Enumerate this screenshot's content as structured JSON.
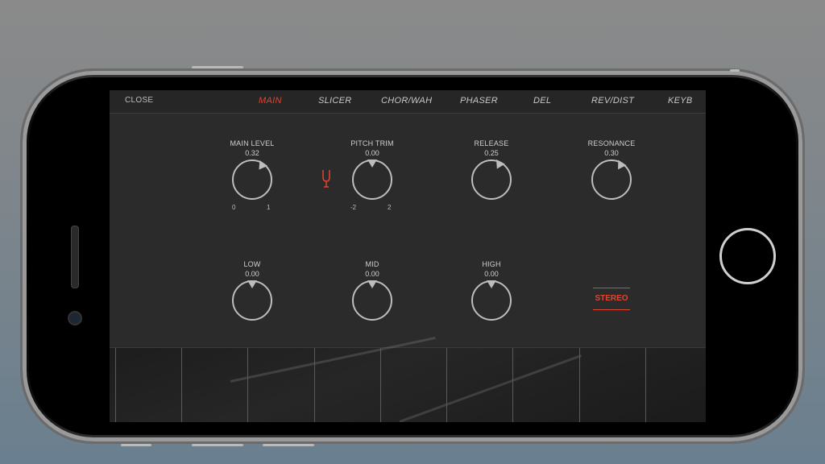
{
  "nav": {
    "close_label": "CLOSE",
    "tabs": [
      {
        "label": "MAIN",
        "active": true
      },
      {
        "label": "SLICER",
        "active": false
      },
      {
        "label": "CHOR/WAH",
        "active": false
      },
      {
        "label": "PHASER",
        "active": false
      },
      {
        "label": "DEL",
        "active": false
      },
      {
        "label": "REV/DIST",
        "active": false
      },
      {
        "label": "KEYB",
        "active": false
      }
    ]
  },
  "knobs": {
    "main_level": {
      "label": "MAIN LEVEL",
      "value": "0.32",
      "min": "0",
      "max": "1"
    },
    "pitch_trim": {
      "label": "PITCH TRIM",
      "value": "0.00",
      "min": "-2",
      "max": "2"
    },
    "release": {
      "label": "RELEASE",
      "value": "0.25"
    },
    "resonance": {
      "label": "RESONANCE",
      "value": "0.30"
    },
    "low": {
      "label": "LOW",
      "value": "0.00"
    },
    "mid": {
      "label": "MID",
      "value": "0.00"
    },
    "high": {
      "label": "HIGH",
      "value": "0.00"
    }
  },
  "stereo_label": "STEREO",
  "tuner_icon": "tuning-fork-icon",
  "colors": {
    "accent": "#e0452f",
    "panel": "#2b2b2b",
    "knob": "#bdbdbd"
  },
  "keyboard": {
    "white_keys": 9
  }
}
